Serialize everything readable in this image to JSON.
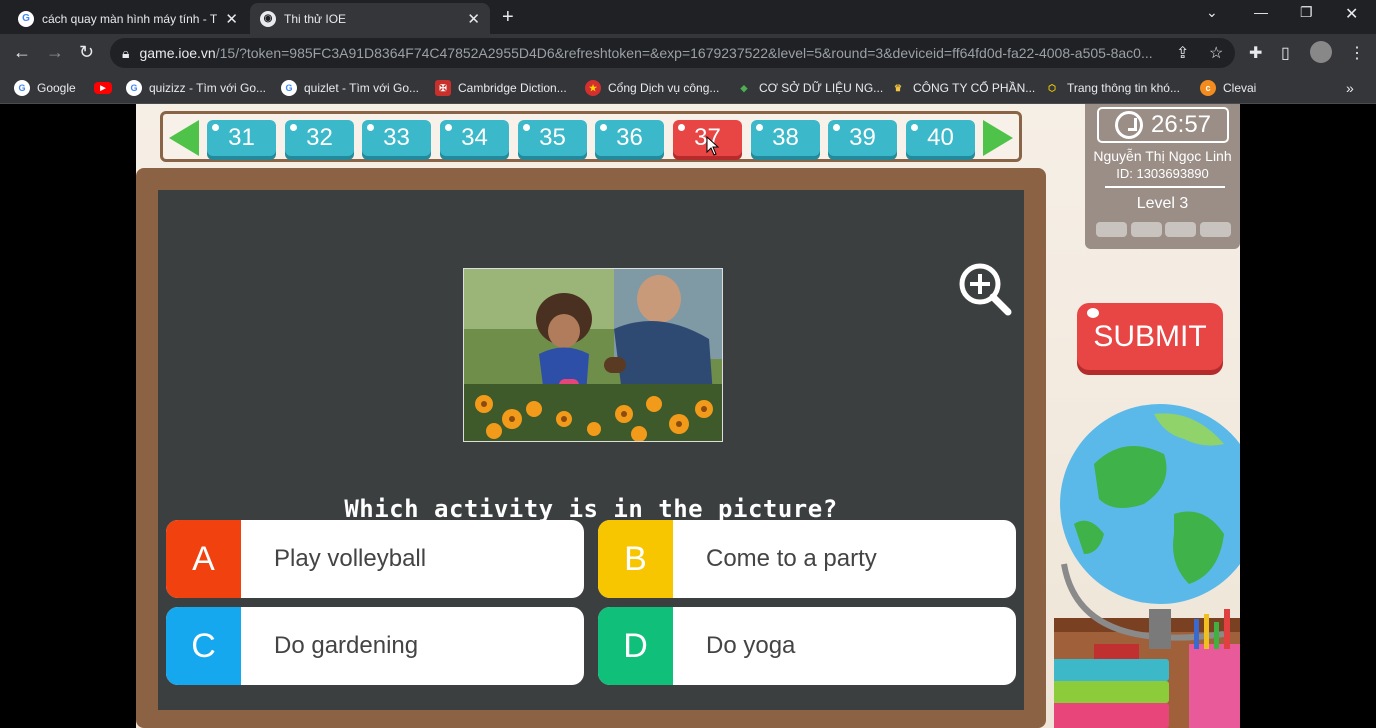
{
  "browser": {
    "tabs": [
      {
        "title": "cách quay màn hình máy tính - T",
        "favicon": "google-icon"
      },
      {
        "title": "Thi thử IOE",
        "favicon": "ioe-icon"
      }
    ],
    "url_host": "game.ioe.vn",
    "url_path": "/15/?token=985FC3A91D8364F74C47852A2955D4D6&refreshtoken=&exp=1679237522&level=5&round=3&deviceid=ff64fd0d-fa22-4008-a505-8ac0...",
    "bookmarks": [
      {
        "label": "Google"
      },
      {
        "label": ""
      },
      {
        "label": "quizizz - Tìm với Go..."
      },
      {
        "label": "quizlet - Tìm với Go..."
      },
      {
        "label": "Cambridge Diction..."
      },
      {
        "label": "Cổng Dịch vụ công..."
      },
      {
        "label": "CƠ SỞ DỮ LIỆU NG..."
      },
      {
        "label": "CÔNG TY CỔ PHẦN..."
      },
      {
        "label": "Trang thông tin khó..."
      },
      {
        "label": "Clevai"
      }
    ]
  },
  "game": {
    "questions": [
      "31",
      "32",
      "33",
      "34",
      "35",
      "36",
      "37",
      "38",
      "39",
      "40"
    ],
    "active_question": "37",
    "timer": "26:57",
    "user_name": "Nguyễn Thị Ngọc  Linh",
    "user_id": "ID: 1303693890",
    "level": "Level 3",
    "submit_label": "SUBMIT",
    "question_text": "Which activity is in the picture?",
    "answers": [
      {
        "letter": "A",
        "text": "Play volleyball",
        "color": "#f0410f"
      },
      {
        "letter": "B",
        "text": "Come to a party",
        "color": "#f7c600"
      },
      {
        "letter": "C",
        "text": "Do gardening",
        "color": "#16a8ef"
      },
      {
        "letter": "D",
        "text": "Do yoga",
        "color": "#10c07a"
      }
    ]
  }
}
